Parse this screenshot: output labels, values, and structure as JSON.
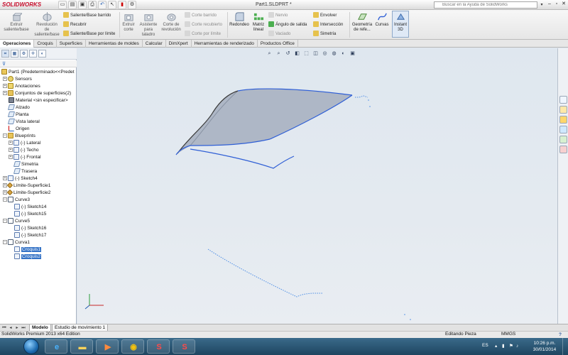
{
  "app": {
    "logo": "SOLIDWORKS",
    "document_title": "Part1.SLDPRT *",
    "help_search_placeholder": "Buscar en la Ayuda de SolidWorks"
  },
  "ribbon": {
    "extruir_saliente": "Extruir\nsaliente/base",
    "revolucion_saliente": "Revolución\nde\nsaliente/base",
    "saliente_barrido": "Saliente/Base barrido",
    "recubrir": "Recubrir",
    "saliente_limite": "Saliente/Base por límite",
    "extruir_corte": "Extruir\ncorte",
    "asistente_taladro": "Asistente\npara\ntaladro",
    "corte_revolucion": "Corte de\nrevolución",
    "corte_barrido": "Corte barrido",
    "corte_recubierto": "Corte recubierto",
    "corte_limite": "Corte por límite",
    "redondeo": "Redondeo",
    "matriz_lineal": "Matriz\nlineal",
    "nervio": "Nervio",
    "angulo_salida": "Ángulo de salida",
    "vaciado": "Vaciado",
    "envolver": "Envolver",
    "interseccion": "Intersección",
    "simetria": "Simetría",
    "geometria_ref": "Geometría\nde refe...",
    "curvas": "Curvas",
    "instant3d": "Instant\n3D"
  },
  "tabs": [
    "Operaciones",
    "Croquis",
    "Superficies",
    "Herramientas de moldes",
    "Calcular",
    "DimXpert",
    "Herramientas de renderizado",
    "Productos Office"
  ],
  "tree": {
    "root": "Part1  (Predeterminado<<Predet",
    "items": [
      {
        "label": "Sensors"
      },
      {
        "label": "Anotaciones"
      },
      {
        "label": "Conjuntos de superficies(2)"
      },
      {
        "label": "Material <sin especificar>"
      },
      {
        "label": "Alzado"
      },
      {
        "label": "Planta"
      },
      {
        "label": "Vista lateral"
      },
      {
        "label": "Origen"
      },
      {
        "label": "Blueprints"
      },
      {
        "label": "(-) Lateral"
      },
      {
        "label": "(-) Techo"
      },
      {
        "label": "(-) Frontal"
      },
      {
        "label": "Simetria"
      },
      {
        "label": "Trasera"
      },
      {
        "label": "(-) Sketch4"
      },
      {
        "label": "Límite-Superficie1"
      },
      {
        "label": "Límite-Superficie2"
      },
      {
        "label": "Curve3"
      },
      {
        "label": "(-) Sketch14"
      },
      {
        "label": "(-) Sketch15"
      },
      {
        "label": "Curve5"
      },
      {
        "label": "(-) Sketch16"
      },
      {
        "label": "(-) Sketch17"
      },
      {
        "label": "Curva1"
      },
      {
        "label": "Croquis1"
      },
      {
        "label": "Croquis2"
      }
    ]
  },
  "bottom_tabs": [
    "Modelo",
    "Estudio de movimiento 1"
  ],
  "status": {
    "left": "SolidWorks Premium 2013 x64 Edition",
    "mode": "Editando Pieza",
    "units": "MMGS",
    "help": "?"
  },
  "taskbar": {
    "lang": "ES",
    "time": "10:26 p.m.",
    "date": "30/01/2014"
  },
  "colors": {
    "accent": "#3573c6",
    "sketch_blue": "#2f5fd6",
    "point_blue": "#4f8fe6"
  }
}
